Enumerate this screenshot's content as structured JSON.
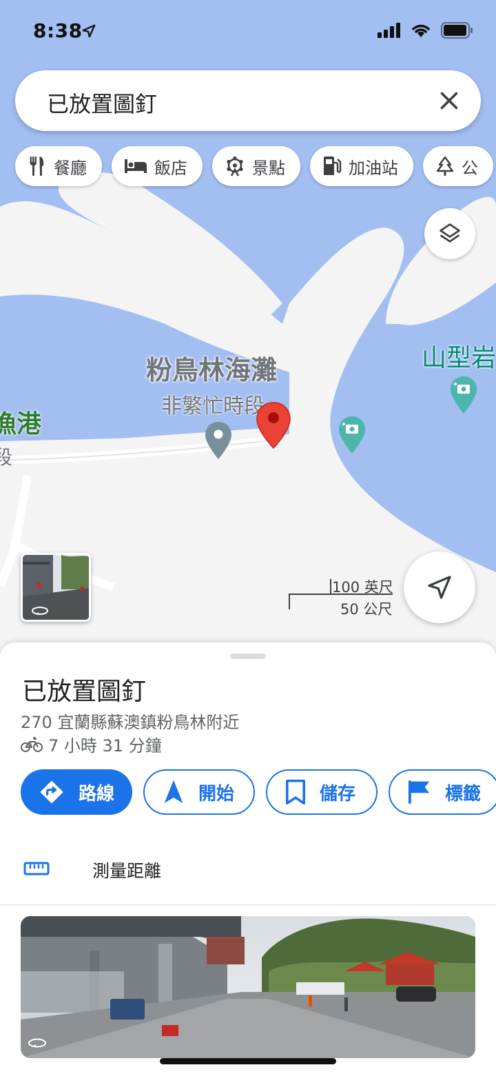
{
  "status": {
    "time": "8:38"
  },
  "search": {
    "text": "已放置圖釘"
  },
  "chips": [
    {
      "icon": "restaurant-icon",
      "label": "餐廳"
    },
    {
      "icon": "hotel-icon",
      "label": "飯店"
    },
    {
      "icon": "attractions-icon",
      "label": "景點"
    },
    {
      "icon": "gas-station-icon",
      "label": "加油站"
    },
    {
      "icon": "park-icon",
      "label": "公"
    }
  ],
  "map": {
    "beach_label": "粉鳥林海灘",
    "beach_status": "非繁忙時段",
    "harbor_label": "漁港",
    "harbor_sub": "段",
    "rock_label": "山型岩",
    "scale_imperial": "100 英尺",
    "scale_metric": "50 公尺",
    "colors": {
      "water": "#a3bef1",
      "land": "#f5f5f5",
      "pin": "#ea4335",
      "poi_teal": "#4db6ac"
    }
  },
  "place": {
    "title": "已放置圖釘",
    "address": "270 宜蘭縣蘇澳鎮粉鳥林附近",
    "duration": "7 小時 31 分鐘",
    "actions": [
      {
        "icon": "directions-icon",
        "label": "路線"
      },
      {
        "icon": "navigate-start-icon",
        "label": "開始"
      },
      {
        "icon": "bookmark-icon",
        "label": "儲存"
      },
      {
        "icon": "flag-icon",
        "label": "標籤"
      }
    ],
    "measure_label": "測量距離"
  }
}
